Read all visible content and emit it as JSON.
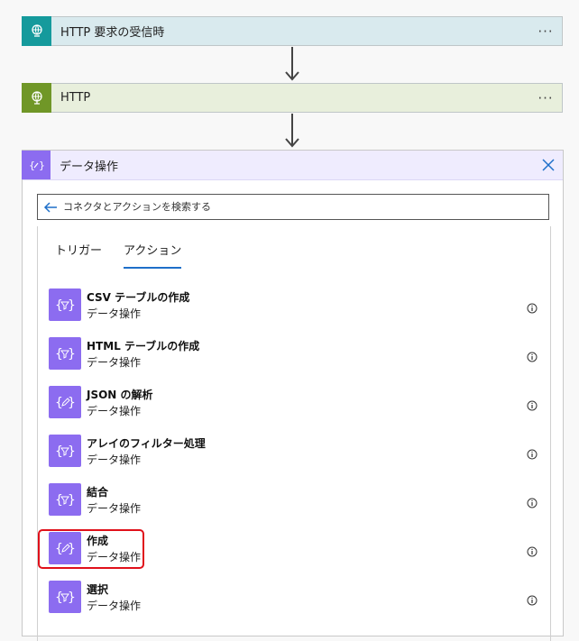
{
  "steps": [
    {
      "title": "HTTP 要求の受信時",
      "more_label": "···",
      "icon": "globe-request-icon"
    },
    {
      "title": "HTTP",
      "more_label": "···",
      "icon": "globe-http-icon"
    }
  ],
  "panel": {
    "title": "データ操作",
    "icon": "data-operation-icon",
    "close_icon": "close-icon"
  },
  "search": {
    "placeholder": "コネクタとアクションを検索する",
    "value": ""
  },
  "tabs": [
    {
      "label": "トリガー",
      "active": false
    },
    {
      "label": "アクション",
      "active": true
    }
  ],
  "actions": [
    {
      "name": "CSV テーブルの作成",
      "connector": "データ操作",
      "icon": "braces-filter-icon"
    },
    {
      "name": "HTML テーブルの作成",
      "connector": "データ操作",
      "icon": "braces-filter-icon"
    },
    {
      "name": "JSON の解析",
      "connector": "データ操作",
      "icon": "braces-pen-icon"
    },
    {
      "name": "アレイのフィルター処理",
      "connector": "データ操作",
      "icon": "braces-filter-icon"
    },
    {
      "name": "結合",
      "connector": "データ操作",
      "icon": "braces-filter-icon"
    },
    {
      "name": "作成",
      "connector": "データ操作",
      "icon": "braces-pen-icon",
      "highlighted": true
    },
    {
      "name": "選択",
      "connector": "データ操作",
      "icon": "braces-filter-icon"
    }
  ],
  "colors": {
    "trigger_accent": "#159a9c",
    "http_accent": "#709727",
    "data_op_accent": "#8c6cf0",
    "active_tab_underline": "#1e6fc9",
    "highlight": "#e0101a"
  }
}
